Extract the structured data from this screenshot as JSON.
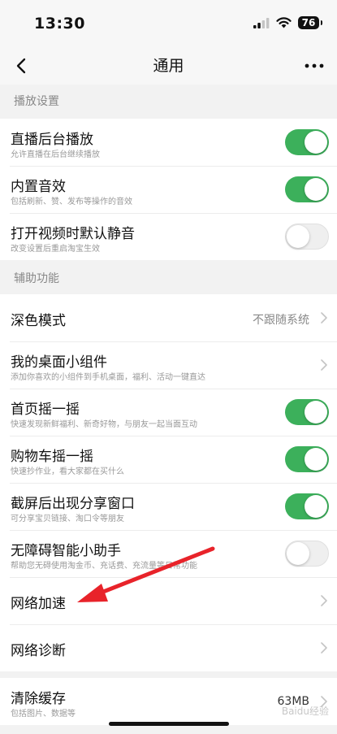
{
  "status_bar": {
    "time": "13:30",
    "battery": "76"
  },
  "nav": {
    "title": "通用"
  },
  "sections": {
    "playback": "播放设置",
    "assist": "辅助功能"
  },
  "rows": {
    "live_bg": {
      "title": "直播后台播放",
      "subtitle": "允许直播在后台继续播放",
      "on": true
    },
    "builtin_sound": {
      "title": "内置音效",
      "subtitle": "包括刷新、赞、发布等操作的音效",
      "on": true
    },
    "mute_default": {
      "title": "打开视频时默认静音",
      "subtitle": "改变设置后重启淘宝生效",
      "on": false
    },
    "dark_mode": {
      "title": "深色模式",
      "value": "不跟随系统"
    },
    "widget": {
      "title": "我的桌面小组件",
      "subtitle": "添加你喜欢的小组件到手机桌面，福利、活动一键直达"
    },
    "home_shake": {
      "title": "首页摇一摇",
      "subtitle": "快速发现新鲜福利、新奇好物，与朋友一起当面互动",
      "on": true
    },
    "cart_shake": {
      "title": "购物车摇一摇",
      "subtitle": "快速抄作业，看大家都在买什么",
      "on": true
    },
    "screenshot_share": {
      "title": "截屏后出现分享窗口",
      "subtitle": "可分享宝贝链接、淘口令等朋友",
      "on": true
    },
    "accessibility": {
      "title": "无障碍智能小助手",
      "subtitle": "帮助您无碍使用淘金币、充话费、充流量等日常功能",
      "on": false
    },
    "network_boost": {
      "title": "网络加速"
    },
    "network_diag": {
      "title": "网络诊断"
    },
    "clear_cache": {
      "title": "清除缓存",
      "subtitle": "包括图片、数据等",
      "value": "63MB"
    }
  },
  "watermark": "Baidu经验",
  "colors": {
    "toggle_on": "#3cb05b",
    "annotation_arrow": "#e8232a"
  }
}
